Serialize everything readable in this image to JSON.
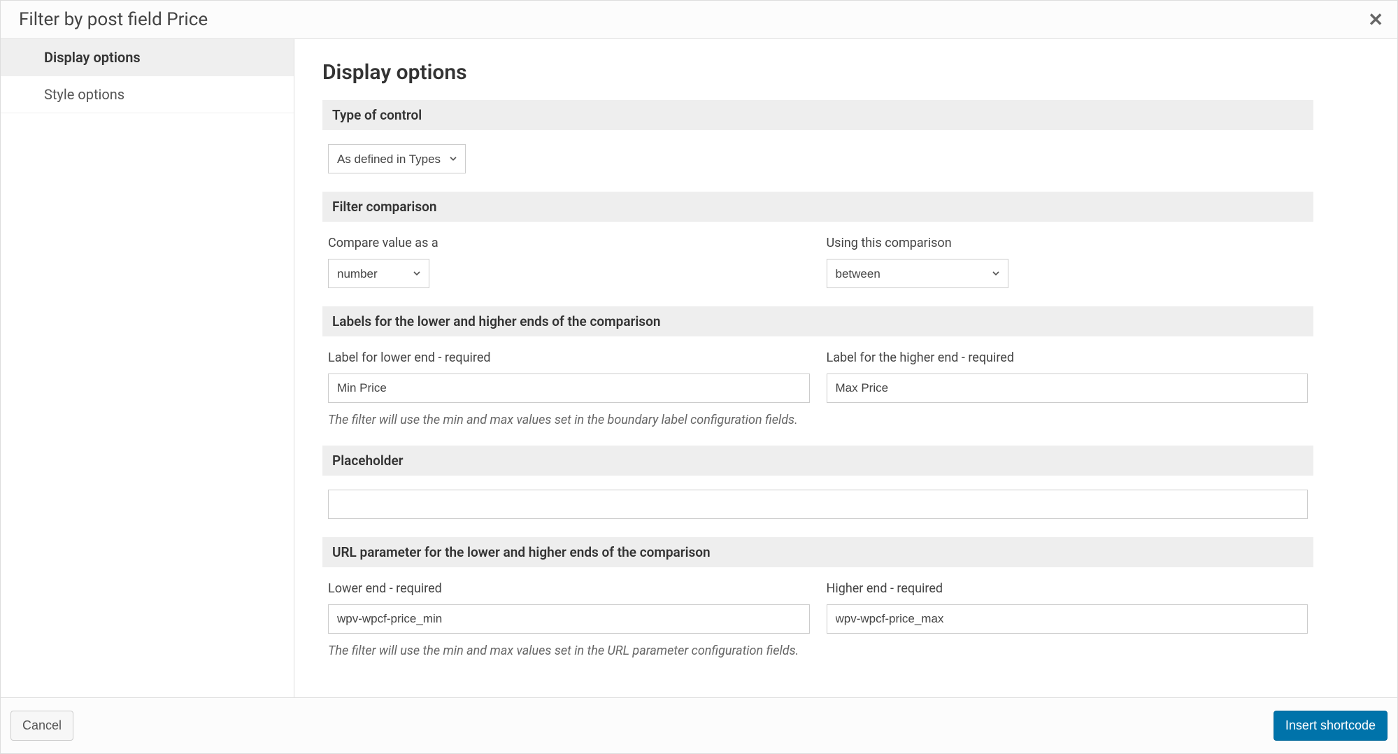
{
  "dialog": {
    "title": "Filter by post field Price"
  },
  "sidebar": {
    "items": [
      {
        "label": "Display options",
        "active": true
      },
      {
        "label": "Style options",
        "active": false
      }
    ]
  },
  "main": {
    "heading": "Display options",
    "typeOfControl": {
      "header": "Type of control",
      "value": "As defined in Types"
    },
    "filterComparison": {
      "header": "Filter comparison",
      "compareLabel": "Compare value as a",
      "compareValue": "number",
      "usingLabel": "Using this comparison",
      "usingValue": "between"
    },
    "labels": {
      "header": "Labels for the lower and higher ends of the comparison",
      "lowerLabel": "Label for lower end - required",
      "lowerValue": "Min Price",
      "higherLabel": "Label for the higher end - required",
      "higherValue": "Max Price",
      "hint": "The filter will use the min and max values set in the boundary label configuration fields."
    },
    "placeholder": {
      "header": "Placeholder",
      "value": ""
    },
    "urlParam": {
      "header": "URL parameter for the lower and higher ends of the comparison",
      "lowerLabel": "Lower end - required",
      "lowerValue": "wpv-wpcf-price_min",
      "higherLabel": "Higher end - required",
      "higherValue": "wpv-wpcf-price_max",
      "hint": "The filter will use the min and max values set in the URL parameter configuration fields."
    }
  },
  "footer": {
    "cancel": "Cancel",
    "insert": "Insert shortcode"
  }
}
